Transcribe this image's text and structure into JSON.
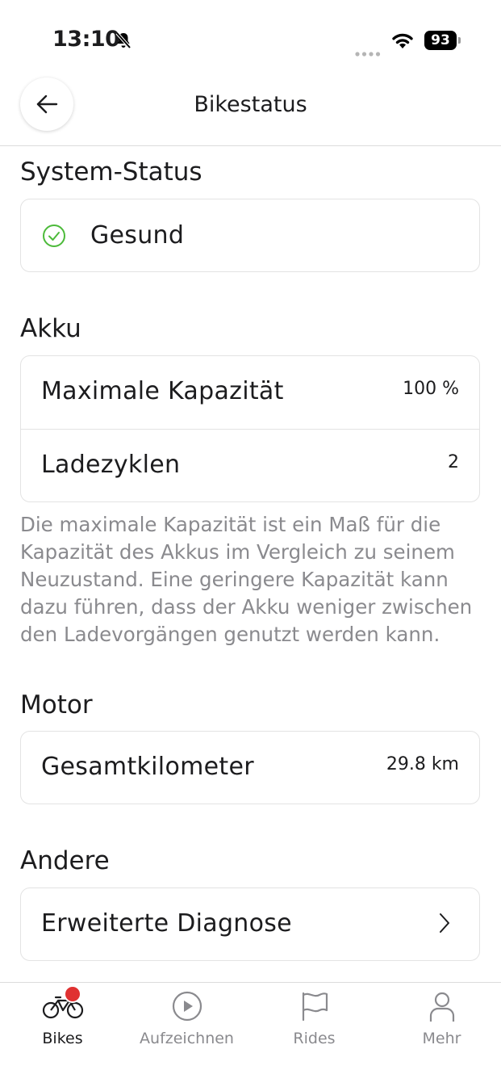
{
  "status_bar": {
    "time": "13:10",
    "battery": "93"
  },
  "nav": {
    "title": "Bikestatus",
    "back_icon": "arrow-left-icon"
  },
  "system_status": {
    "title": "System-Status",
    "status": "Gesund",
    "status_icon": "check-circle-icon",
    "status_color": "#4cba3a"
  },
  "akku": {
    "title": "Akku",
    "rows": [
      {
        "label": "Maximale Kapazität",
        "value": "100 %"
      },
      {
        "label": "Ladezyklen",
        "value": "2"
      }
    ],
    "description": "Die maximale Kapazität ist ein Maß für die Kapazität des Akkus im Vergleich zu seinem Neuzustand. Eine geringere Kapazität kann dazu führen, dass der Akku weniger zwischen den Ladevorgängen genutzt werden kann."
  },
  "motor": {
    "title": "Motor",
    "rows": [
      {
        "label": "Gesamtkilometer",
        "value": "29.8 km"
      }
    ]
  },
  "andere": {
    "title": "Andere",
    "rows": [
      {
        "label": "Erweiterte Diagnose",
        "icon": "chevron-right-icon"
      }
    ]
  },
  "tabbar": {
    "tabs": [
      {
        "label": "Bikes",
        "icon": "bike-icon",
        "active": true,
        "badge": true
      },
      {
        "label": "Aufzeichnen",
        "icon": "play-circle-icon"
      },
      {
        "label": "Rides",
        "icon": "flag-icon"
      },
      {
        "label": "Mehr",
        "icon": "person-icon"
      }
    ],
    "badge_color": "#e03131"
  }
}
